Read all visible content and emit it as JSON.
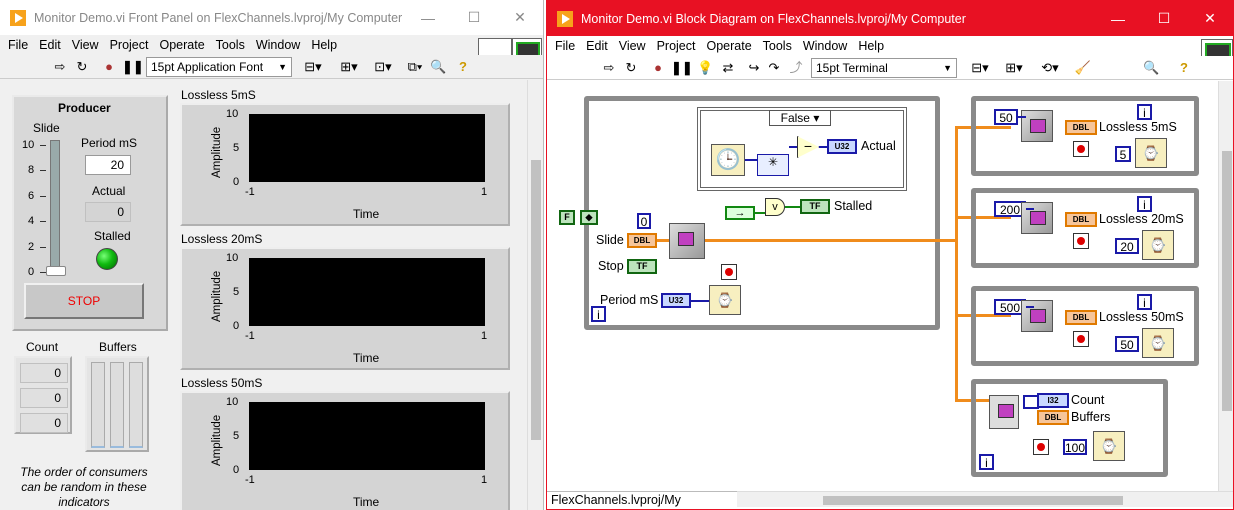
{
  "front_panel": {
    "title": "Monitor Demo.vi Front Panel on FlexChannels.lvproj/My Computer",
    "menu": [
      "File",
      "Edit",
      "View",
      "Project",
      "Operate",
      "Tools",
      "Window",
      "Help"
    ],
    "font": "15pt Application Font",
    "producer": {
      "heading": "Producer",
      "slide_label": "Slide",
      "slide_ticks": [
        "10",
        "8",
        "6",
        "4",
        "2",
        "0"
      ],
      "slide_value": 0,
      "period_label": "Period mS",
      "period_value": "20",
      "actual_label": "Actual",
      "actual_value": "0",
      "stalled_label": "Stalled",
      "stop_label": "STOP"
    },
    "count_label": "Count",
    "count_values": [
      "0",
      "0",
      "0"
    ],
    "buffers_label": "Buffers",
    "hint": "The order of consumers can be random in these indicators",
    "graphs": [
      {
        "title": "Lossless 5mS",
        "ylabel": "Amplitude",
        "xlabel": "Time",
        "yticks": [
          "10",
          "5",
          "0"
        ],
        "xticks": [
          "-1",
          "1"
        ]
      },
      {
        "title": "Lossless 20mS",
        "ylabel": "Amplitude",
        "xlabel": "Time",
        "yticks": [
          "10",
          "5",
          "0"
        ],
        "xticks": [
          "-1",
          "1"
        ]
      },
      {
        "title": "Lossless 50mS",
        "ylabel": "Amplitude",
        "xlabel": "Time",
        "yticks": [
          "10",
          "5",
          "0"
        ],
        "xticks": [
          "-1",
          "1"
        ]
      }
    ]
  },
  "block_diagram": {
    "title": "Monitor Demo.vi Block Diagram on FlexChannels.lvproj/My Computer",
    "menu": [
      "File",
      "Edit",
      "View",
      "Project",
      "Operate",
      "Tools",
      "Window",
      "Help"
    ],
    "font": "15pt Terminal",
    "case_selector": "False",
    "labels": {
      "actual": "Actual",
      "stalled": "Stalled",
      "slide": "Slide",
      "stop": "Stop",
      "period": "Period mS",
      "count": "Count",
      "buffers": "Buffers",
      "false_const": "F",
      "zero_const": "0",
      "iter": "i",
      "dbl": "DBL",
      "tf": "TF",
      "u32": "U32",
      "i32": "I32"
    },
    "consumers": [
      {
        "const": "50",
        "name": "Lossless 5mS",
        "wait": "5"
      },
      {
        "const": "200",
        "name": "Lossless 20mS",
        "wait": "20"
      },
      {
        "const": "500",
        "name": "Lossless 50mS",
        "wait": "50"
      }
    ],
    "monitor_wait": "100",
    "status_path": "FlexChannels.lvproj/My Computer"
  }
}
